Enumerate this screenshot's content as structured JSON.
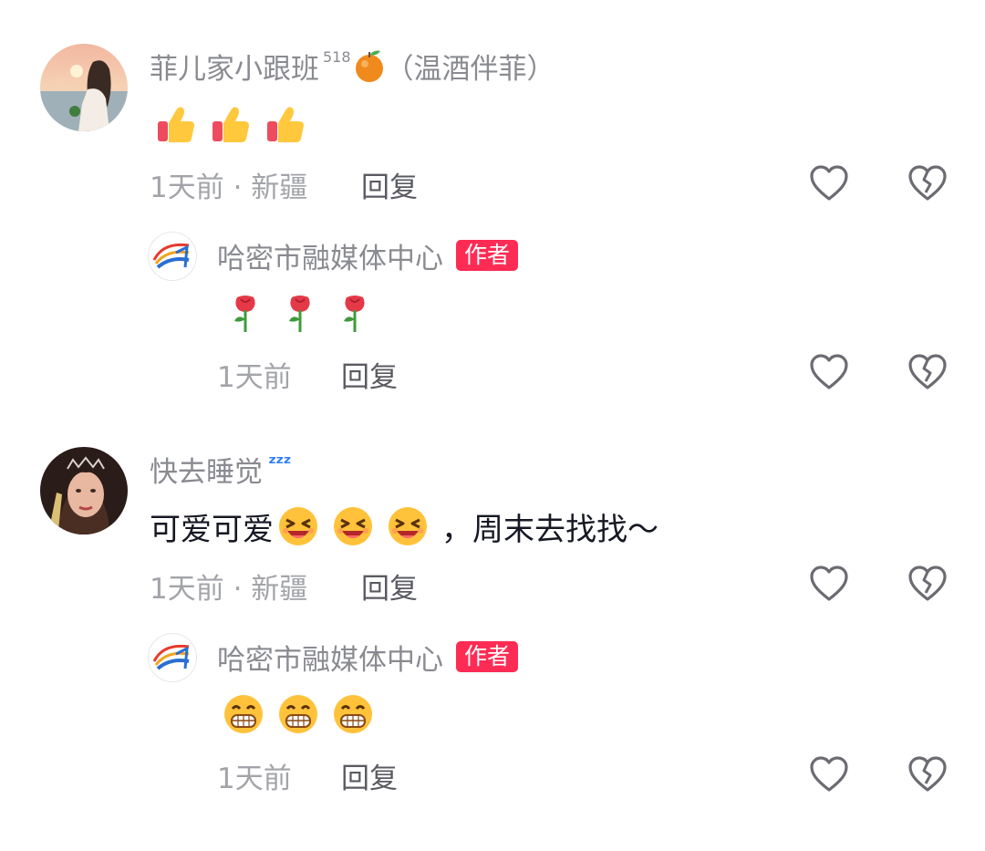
{
  "comments": [
    {
      "username": "菲儿家小跟班",
      "level": "518",
      "suffix": "（温酒伴菲）",
      "meta": "1天前 · 新疆",
      "reply_label": "回复",
      "emojis": [
        "thumbs-up",
        "thumbs-up",
        "thumbs-up"
      ],
      "reply": {
        "username": "哈密市融媒体中心",
        "tag": "作者",
        "meta": "1天前",
        "reply_label": "回复",
        "emojis": [
          "rose",
          "rose",
          "rose"
        ]
      }
    },
    {
      "username": "快去睡觉",
      "body_prefix": "可爱可爱",
      "body_suffix": "，周末去找找～",
      "meta": "1天前 · 新疆",
      "reply_label": "回复",
      "emojis": [
        "laughing",
        "laughing",
        "laughing"
      ],
      "reply": {
        "username": "哈密市融媒体中心",
        "tag": "作者",
        "meta": "1天前",
        "reply_label": "回复",
        "emojis": [
          "grinning",
          "grinning",
          "grinning"
        ]
      }
    }
  ],
  "icons": {
    "like": "heart-icon",
    "dislike": "broken-heart-icon"
  },
  "colors": {
    "author_tag": "#fe2c55",
    "name": "#8a8b91",
    "meta": "#a3a4a9"
  }
}
